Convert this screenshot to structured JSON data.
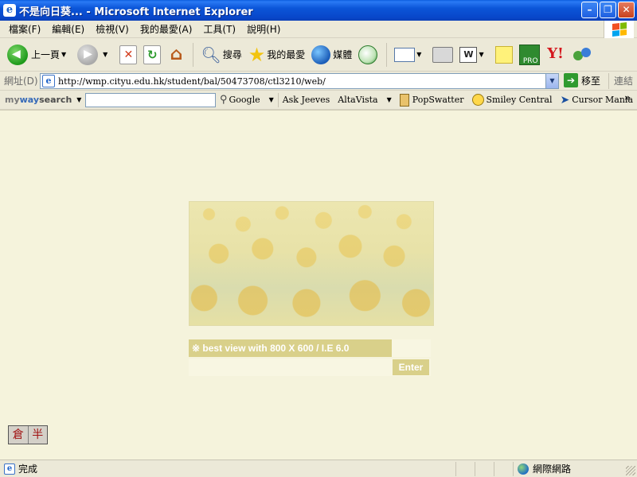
{
  "window": {
    "title": "不是向日葵... - Microsoft Internet Explorer",
    "minimize": "–",
    "maximize": "❐",
    "close": "✕"
  },
  "menu": [
    "檔案(F)",
    "編輯(E)",
    "檢視(V)",
    "我的最愛(A)",
    "工具(T)",
    "說明(H)"
  ],
  "toolbar": {
    "back_label": "上一頁",
    "search_label": "搜尋",
    "favorites_label": "我的最愛",
    "media_label": "媒體",
    "word_glyph": "W",
    "icq_tag": "PRO",
    "yahoo_glyph": "Y!"
  },
  "address": {
    "label": "網址(D)",
    "url": "http://wmp.cityu.edu.hk/student/bal/50473708/ctl3210/web/",
    "go_label": "移至",
    "links_label": "連結"
  },
  "searchbar": {
    "logo_my": "my",
    "logo_way": "way",
    "logo_search": "search",
    "items": [
      "Google",
      "Ask Jeeves",
      "AltaVista",
      "PopSwatter",
      "Smiley Central",
      "Cursor Mania"
    ],
    "more": "»"
  },
  "page": {
    "best_view_note": "※ best view with 800 X 600 / I.E 6.0",
    "enter_label": "Enter",
    "ime": [
      "倉",
      "半"
    ]
  },
  "status": {
    "text": "完成",
    "zone": "網際網路"
  }
}
